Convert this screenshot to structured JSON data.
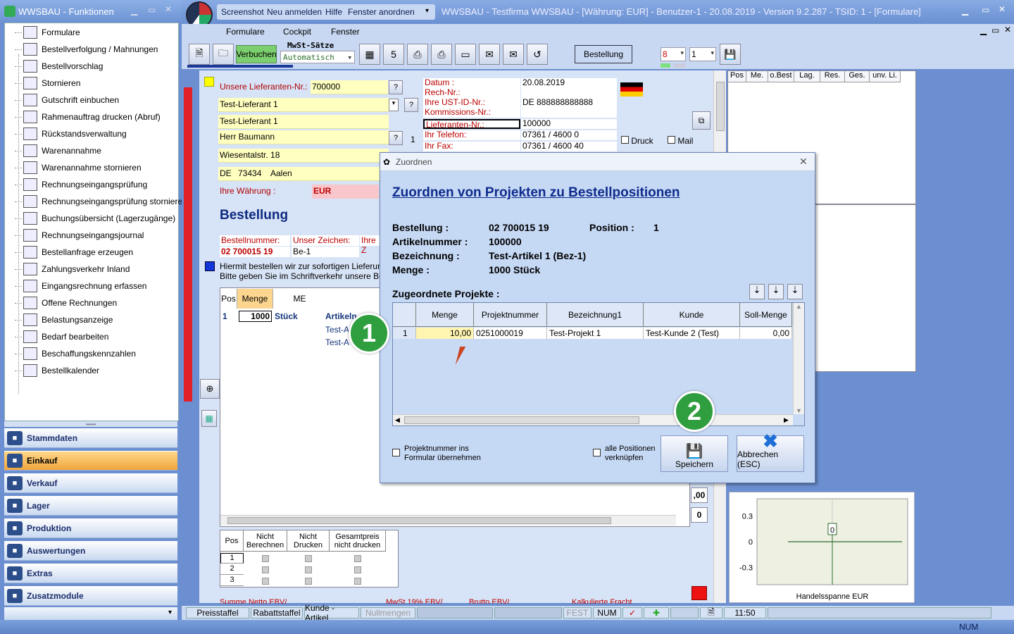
{
  "left_window": {
    "title": "WWSBAU - Funktionen",
    "tree_items": [
      {
        "label": "Formulare",
        "icon": "document-icon"
      },
      {
        "label": "Bestellverfolgung / Mahnungen",
        "icon": "map-icon"
      },
      {
        "label": "Bestellvorschlag",
        "icon": "cart-icon"
      },
      {
        "label": "Stornieren",
        "icon": "cart-cancel-icon"
      },
      {
        "label": "Gutschrift einbuchen",
        "icon": "credit-icon"
      },
      {
        "label": "Rahmenauftrag drucken (Abruf)",
        "icon": "print-document-icon"
      },
      {
        "label": "Rückstandsverwaltung",
        "icon": "clock-icon"
      },
      {
        "label": "Warenannahme",
        "icon": "goods-icon"
      },
      {
        "label": "Warenannahme stornieren",
        "icon": "goods-cancel-icon"
      },
      {
        "label": "Rechnungseingangsprüfung",
        "icon": "euro-check-icon"
      },
      {
        "label": "Rechnungseingangsprüfung stornieren",
        "icon": "euro-cancel-icon"
      },
      {
        "label": "Buchungsübersicht (Lagerzugänge)",
        "icon": "list-icon"
      },
      {
        "label": "Rechnungseingangsjournal",
        "icon": "journal-icon"
      },
      {
        "label": "Bestellanfrage erzeugen",
        "icon": "request-icon"
      },
      {
        "label": "Zahlungsverkehr Inland",
        "icon": "payment-icon"
      },
      {
        "label": "Eingangsrechnung erfassen",
        "icon": "invoice-icon"
      },
      {
        "label": "Offene Rechnungen",
        "icon": "open-invoice-icon"
      },
      {
        "label": "Belastungsanzeige",
        "icon": "weight-icon"
      },
      {
        "label": "Bedarf bearbeiten",
        "icon": "demand-icon"
      },
      {
        "label": "Beschaffungskennzahlen",
        "icon": "chart-icon"
      },
      {
        "label": "Bestellkalender",
        "icon": "calendar-icon"
      }
    ],
    "nav_buttons": [
      {
        "label": "Stammdaten",
        "active": false
      },
      {
        "label": "Einkauf",
        "active": true
      },
      {
        "label": "Verkauf",
        "active": false
      },
      {
        "label": "Lager",
        "active": false
      },
      {
        "label": "Produktion",
        "active": false
      },
      {
        "label": "Auswertungen",
        "active": false
      },
      {
        "label": "Extras",
        "active": false
      },
      {
        "label": "Zusatzmodule",
        "active": false
      }
    ]
  },
  "main_window": {
    "top_menu": [
      "Screenshot",
      "Neu anmelden",
      "Hilfe",
      "Fenster anordnen"
    ],
    "title": "WWSBAU - Testfirma WWSBAU - [Währung: EUR] - Benutzer-1 - 20.08.2019 - Version 9.2.287 - TSID: 1  - [Formulare]",
    "menu": [
      "Formulare",
      "Cockpit",
      "Fenster"
    ],
    "toolbar": {
      "verbuchen": "Verbuchen",
      "mwst_label": "MwSt-Sätze",
      "mwst_value": "Automatisch",
      "bestellung_button": "Bestellung",
      "combo1": "8",
      "combo2": "1"
    }
  },
  "form": {
    "unsere_lieferanten_label": "Unsere Lieferanten-Nr.:",
    "unsere_lieferanten_value": "700000",
    "address_lines": [
      "Test-Lieferant 1",
      "Test-Lieferant 1",
      "Herr Baumann",
      "Wiesentalstr. 18"
    ],
    "country": "DE",
    "zip": "73434",
    "city": "Aalen",
    "currency_label": "Ihre Währung :",
    "currency_value": "EUR",
    "right_labels": [
      "Datum :",
      "Rech-Nr.:",
      "Ihre UST-ID-Nr.:",
      "Kommissions-Nr.:",
      "Lieferanten-Nr.:",
      "Ihr Telefon:",
      "Ihr Fax:"
    ],
    "right_values": [
      "20.08.2019",
      "",
      "DE 888888888888",
      "",
      "100000",
      "07361 / 4600 0",
      "07361 / 4600 40"
    ],
    "count_value": "1",
    "druck": "Druck",
    "mail": "Mail",
    "title": "Bestellung",
    "bestellnummer_label": "Bestellnummer:",
    "bestellnummer_value": "02 700015 19",
    "unser_zeichen_label": "Unser Zeichen:",
    "unser_zeichen_value": "Be-1",
    "ihre_label": "Ihre Z",
    "text_line1": "Hiermit bestellen wir zur sofortigen Lieferung nac",
    "text_line2": "Bitte geben Sie im Schriftverkehr unsere Bestell",
    "positions_header": [
      "Pos",
      "Menge",
      "ME"
    ],
    "positions_row": {
      "pos": "1",
      "menge": "1000",
      "me": "Stück",
      "art": "Artikeln"
    },
    "positions_extra": [
      "Test-A",
      "Test-A"
    ],
    "lower_table_header": [
      "Pos",
      "Nicht Berechnen",
      "Nicht Drucken",
      "Gesamtpreis nicht drucken"
    ],
    "lower_rows": [
      "1",
      "2",
      "3"
    ],
    "side_buttons": [
      ",00",
      "0"
    ],
    "footer_labels": [
      "Summe Netto EBV/",
      "MwSt 19% EBV/",
      "Brutto EBV/",
      "Kalkulierte Fracht"
    ]
  },
  "right_panel": {
    "grid_headers": [
      "Pos",
      "Me.",
      "o.Best",
      "Lag.",
      "Res.",
      "Ges.",
      "unv. Li."
    ]
  },
  "chart_data": {
    "type": "line",
    "title": "",
    "xlabel": "Handelsspanne EUR",
    "ylabel": "",
    "yticks": [
      "0.3",
      "0",
      "-0.3"
    ],
    "ylim": [
      -0.5,
      0.5
    ],
    "series": [
      {
        "values": [
          0
        ]
      }
    ],
    "annotation": "0"
  },
  "dialog": {
    "title": "Zuordnen",
    "heading": "Zuordnen von Projekten zu Bestellpositionen",
    "bestellung_label": "Bestellung :",
    "bestellung_value": "02 700015 19",
    "position_label": "Position :",
    "position_value": "1",
    "artikelnummer_label": "Artikelnummer :",
    "artikelnummer_value": "100000",
    "bezeichnung_label": "Bezeichnung :",
    "bezeichnung_value": "Test-Artikel 1  (Bez-1)",
    "menge_label": "Menge :",
    "menge_value": "1000 Stück",
    "section_label": "Zugeordnete Projekte :",
    "grid_headers": [
      "Menge",
      "Projektnummer",
      "Bezeichnung1",
      "Kunde",
      "Soll-Menge"
    ],
    "grid_rows": [
      {
        "rownum": "1",
        "menge": "10,00",
        "projektnummer": "0251000019",
        "bezeichnung1": "Test-Projekt 1",
        "kunde": "Test-Kunde 2  (Test)",
        "soll": "0,00"
      }
    ],
    "checkbox1": "Projektnummer ins Formular übernehmen",
    "checkbox2": "alle Positionen verknüpfen",
    "save_button": "Speichern",
    "cancel_button": "Abbrechen (ESC)"
  },
  "badges": [
    "1",
    "2"
  ],
  "statusbar": [
    "Preisstaffel",
    "Rabattstaffel",
    "Kunde - Artikel",
    "Nullmengen",
    "FEST",
    "NUM",
    "11:50"
  ],
  "bottom_num": "NUM"
}
